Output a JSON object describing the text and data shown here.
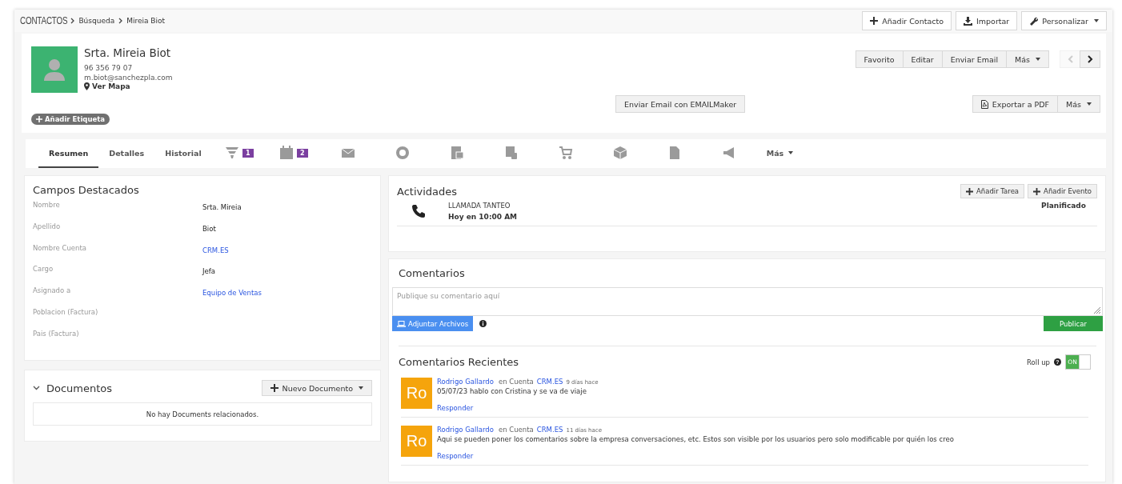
{
  "breadcrumb": {
    "module": "CONTACTOS",
    "items": [
      "Búsqueda",
      "Mireia Biot"
    ]
  },
  "top_actions": [
    {
      "label": "Añadir Contacto",
      "caret": false
    },
    {
      "label": "Importar",
      "caret": false
    },
    {
      "label": "Personalizar",
      "caret": true
    }
  ],
  "contact": {
    "name": "Srta. Mireia Biot",
    "phone": "96 356 79 07",
    "email": "m.biot@sanchezpla.com",
    "map_link": "Ver Mapa",
    "tag_button": "Añadir Etiqueta"
  },
  "record_actions": [
    {
      "label": "Favorito",
      "caret": false
    },
    {
      "label": "Editar",
      "caret": false
    },
    {
      "label": "Enviar Email",
      "caret": false
    },
    {
      "label": "Más",
      "caret": true
    }
  ],
  "pager": {
    "prev_disabled": true,
    "next_disabled": false
  },
  "emailmaker_button": "Enviar Email con EMAILMaker",
  "export_actions": [
    {
      "label": "Exportar a PDF",
      "caret": false
    },
    {
      "label": "Más",
      "caret": true
    }
  ],
  "tabs": [
    {
      "kind": "text",
      "label": "Resumen",
      "selected": true
    },
    {
      "kind": "text",
      "label": "Detalles",
      "selected": false
    },
    {
      "kind": "text",
      "label": "Historial",
      "selected": false
    },
    {
      "kind": "icon",
      "badge": "1",
      "selected": false
    },
    {
      "kind": "icon",
      "badge": "2",
      "selected": false
    },
    {
      "kind": "icon",
      "selected": false
    },
    {
      "kind": "icon",
      "selected": false
    },
    {
      "kind": "icon",
      "selected": false
    },
    {
      "kind": "icon",
      "selected": false
    },
    {
      "kind": "icon",
      "selected": false
    },
    {
      "kind": "icon",
      "selected": false
    },
    {
      "kind": "icon",
      "selected": false
    },
    {
      "kind": "icon",
      "selected": false
    },
    {
      "kind": "more",
      "label": "Más",
      "selected": false
    }
  ],
  "key_fields": {
    "title": "Campos Destacados",
    "rows": [
      {
        "label": "Nombre",
        "value": "Srta. Mireia",
        "kind": "text"
      },
      {
        "label": "Apellido",
        "value": "Biot",
        "kind": "text"
      },
      {
        "label": "Nombre Cuenta",
        "value": "CRM.ES",
        "kind": "link"
      },
      {
        "label": "Cargo",
        "value": "Jefa",
        "kind": "text"
      },
      {
        "label": "Asignado a",
        "value": "Equipo de Ventas",
        "kind": "link"
      },
      {
        "label": "Poblacion (Factura)"
      },
      {
        "label": "Pais (Factura)"
      }
    ]
  },
  "documents": {
    "title": "Documentos",
    "expanded": true,
    "new_button": "Nuevo Documento",
    "empty_text": "No hay Documents relacionados."
  },
  "activities": {
    "title": "Actividades",
    "buttons": [
      "Añadir Tarea",
      "Añadir Evento"
    ],
    "items": [
      {
        "type": "LLAMADA TANTEO",
        "when": "Hoy en 10:00 AM",
        "status": "Planificado"
      }
    ]
  },
  "comments": {
    "title": "Comentarios",
    "placeholder": "Publique su comentario aquí",
    "attach_button": "Adjuntar Archivos",
    "publish_button": "Publicar"
  },
  "recent": {
    "title": "Comentarios Recientes",
    "roll_up_label": "Roll up",
    "roll_up_help": "?",
    "roll_up": {
      "on": true,
      "text": "ON"
    },
    "items": [
      {
        "initials": "Ro",
        "author": "Rodrigo Gallardo",
        "context": "en Cuenta",
        "account": "CRM.ES",
        "time": "9 días hace",
        "text": "05/07/23 hablo con Cristina y se va de viaje",
        "reply": "Responder"
      },
      {
        "initials": "Ro",
        "author": "Rodrigo Gallardo",
        "context": "en Cuenta",
        "account": "CRM.ES",
        "time": "11 días hace",
        "text": "Aqui se pueden poner los comentarios sobre la empresa conversaciones, etc. Estos son visible por los usuarios pero solo modificable por quién los creo",
        "reply": "Responder"
      }
    ]
  }
}
